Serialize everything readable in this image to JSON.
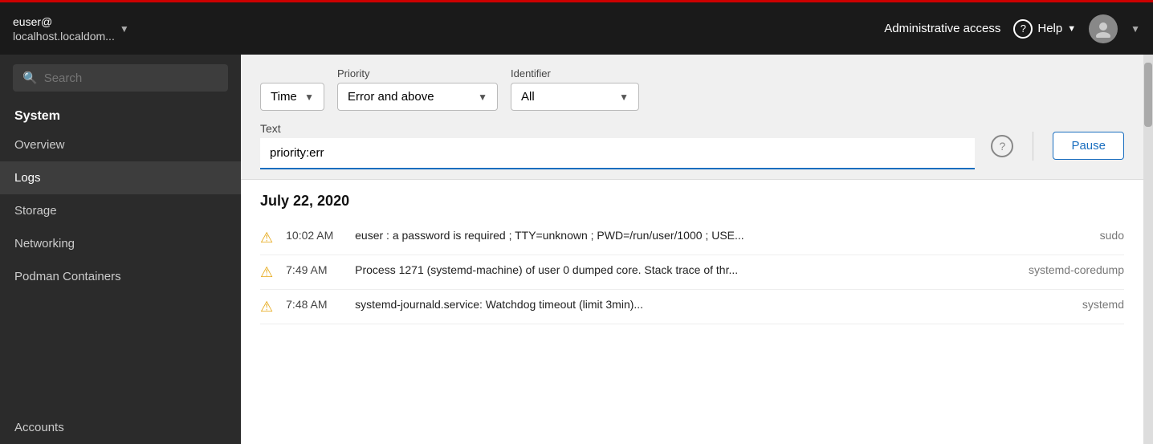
{
  "topbar": {
    "user": "euser@",
    "host": "localhost.localdom...",
    "admin_text": "Administrative access",
    "help_label": "Help",
    "dropdown_arrow": "▼"
  },
  "sidebar": {
    "search_placeholder": "Search",
    "section_label": "System",
    "nav_items": [
      {
        "id": "overview",
        "label": "Overview",
        "active": false
      },
      {
        "id": "logs",
        "label": "Logs",
        "active": true
      },
      {
        "id": "storage",
        "label": "Storage",
        "active": false
      },
      {
        "id": "networking",
        "label": "Networking",
        "active": false
      },
      {
        "id": "podman",
        "label": "Podman Containers",
        "active": false
      },
      {
        "id": "accounts",
        "label": "Accounts",
        "active": false
      }
    ]
  },
  "filters": {
    "time_label": "Time",
    "time_value": "Time",
    "priority_label": "Priority",
    "priority_value": "Error and above",
    "identifier_label": "Identifier",
    "identifier_value": "All",
    "text_label": "Text",
    "text_value": "priority:err",
    "help_icon": "?",
    "pause_label": "Pause"
  },
  "logs": {
    "date": "July 22, 2020",
    "entries": [
      {
        "icon": "⚠",
        "time": "10:02 AM",
        "message": "euser : a password is required ; TTY=unknown ; PWD=/run/user/1000 ; USE...",
        "source": "sudo"
      },
      {
        "icon": "⚠",
        "time": "7:49 AM",
        "message": "Process 1271 (systemd-machine) of user 0 dumped core. Stack trace of thr...",
        "source": "systemd-coredump"
      },
      {
        "icon": "⚠",
        "time": "7:48 AM",
        "message": "systemd-journald.service: Watchdog timeout (limit 3min)...",
        "source": "systemd"
      }
    ]
  }
}
